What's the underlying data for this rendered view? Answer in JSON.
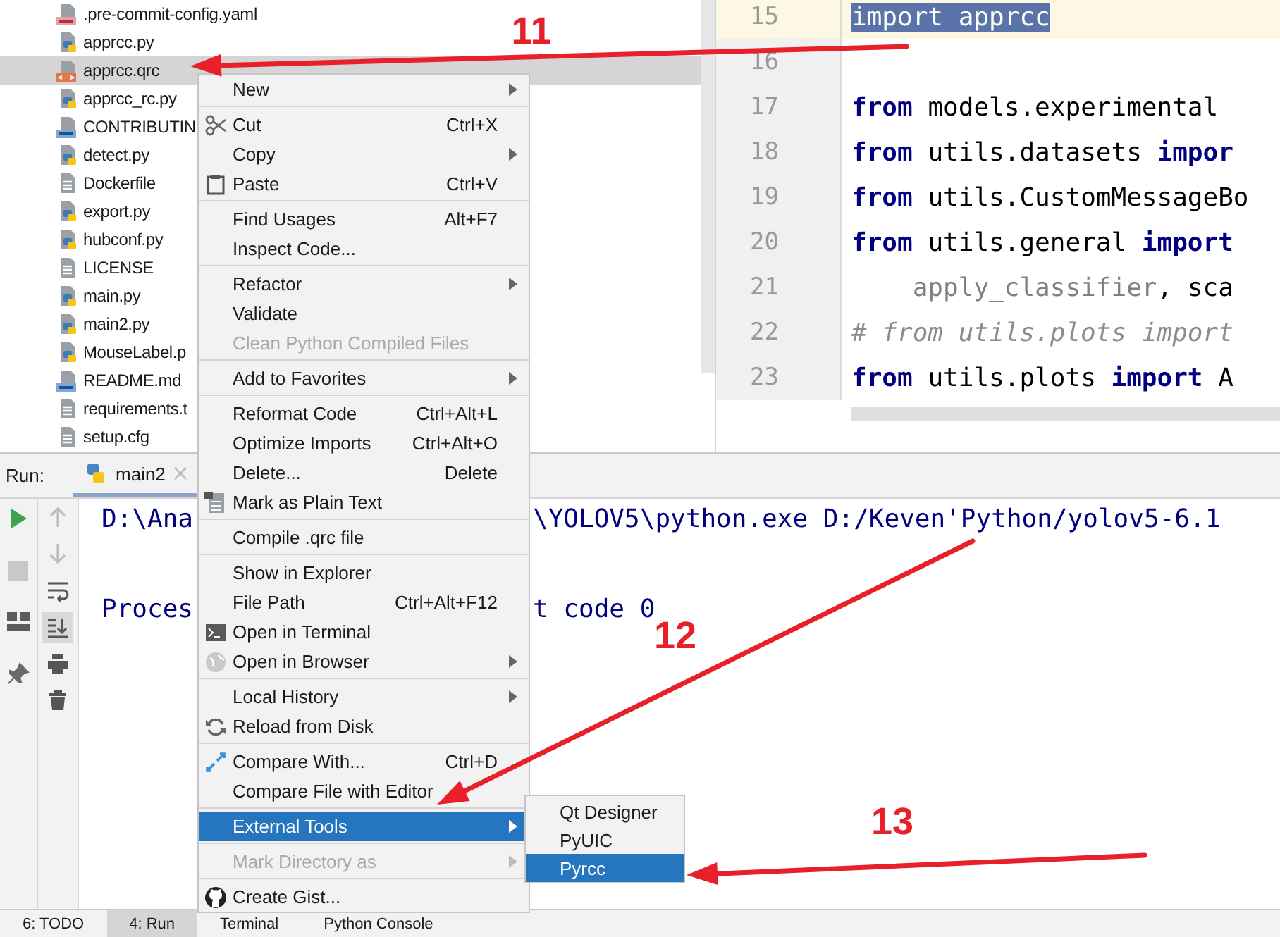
{
  "project_tree": {
    "items": [
      {
        "label": ".pre-commit-config.yaml",
        "kind": "yaml",
        "selected": false
      },
      {
        "label": "apprcc.py",
        "kind": "python",
        "selected": false
      },
      {
        "label": "apprcc.qrc",
        "kind": "qrc",
        "selected": true
      },
      {
        "label": "apprcc_rc.py",
        "kind": "python",
        "selected": false
      },
      {
        "label": "CONTRIBUTIN",
        "kind": "markdown",
        "selected": false
      },
      {
        "label": "detect.py",
        "kind": "python",
        "selected": false
      },
      {
        "label": "Dockerfile",
        "kind": "text",
        "selected": false
      },
      {
        "label": "export.py",
        "kind": "python",
        "selected": false
      },
      {
        "label": "hubconf.py",
        "kind": "python",
        "selected": false
      },
      {
        "label": "LICENSE",
        "kind": "text",
        "selected": false
      },
      {
        "label": "main.py",
        "kind": "python",
        "selected": false
      },
      {
        "label": "main2.py",
        "kind": "python",
        "selected": false
      },
      {
        "label": "MouseLabel.p",
        "kind": "python",
        "selected": false
      },
      {
        "label": "README.md",
        "kind": "markdown",
        "selected": false
      },
      {
        "label": "requirements.t",
        "kind": "text",
        "selected": false
      },
      {
        "label": "setup.cfg",
        "kind": "text",
        "selected": false
      }
    ]
  },
  "editor": {
    "lines": [
      {
        "number": "15",
        "current": true,
        "tokens": [
          {
            "text": "import apprcc",
            "kind": "selection"
          }
        ]
      },
      {
        "number": "16",
        "current": false
      },
      {
        "number": "17",
        "current": false,
        "tokens": [
          {
            "text": "from",
            "kind": "keyword"
          },
          {
            "text": " models.experimental",
            "kind": "plain"
          }
        ]
      },
      {
        "number": "18",
        "current": false,
        "tokens": [
          {
            "text": "from",
            "kind": "keyword"
          },
          {
            "text": " utils.datasets ",
            "kind": "plain"
          },
          {
            "text": "impor",
            "kind": "keyword"
          }
        ]
      },
      {
        "number": "19",
        "current": false,
        "tokens": [
          {
            "text": "from",
            "kind": "keyword"
          },
          {
            "text": " utils.CustomMessageBo",
            "kind": "plain"
          }
        ]
      },
      {
        "number": "20",
        "current": false,
        "tokens": [
          {
            "text": "from",
            "kind": "keyword"
          },
          {
            "text": " utils.general ",
            "kind": "plain"
          },
          {
            "text": "import",
            "kind": "keyword"
          }
        ]
      },
      {
        "number": "21",
        "current": false,
        "tokens": [
          {
            "text": "    apply_classifier",
            "kind": "muted"
          },
          {
            "text": ", sca",
            "kind": "plain"
          }
        ]
      },
      {
        "number": "22",
        "current": false,
        "tokens": [
          {
            "text": "# from utils.plots import",
            "kind": "comment"
          }
        ]
      },
      {
        "number": "23",
        "current": false,
        "tokens": [
          {
            "text": "from",
            "kind": "keyword"
          },
          {
            "text": " utils.plots ",
            "kind": "plain"
          },
          {
            "text": "import",
            "kind": "keyword"
          },
          {
            "text": " A",
            "kind": "plain"
          }
        ]
      }
    ]
  },
  "run_panel": {
    "label": "Run:",
    "tab": "main2",
    "tools": [
      {
        "selected": false
      },
      {
        "selected": false
      },
      {
        "selected": false
      },
      {
        "selected": true
      },
      {
        "selected": false
      },
      {
        "selected": false
      }
    ],
    "console": [
      {
        "left": "D:\\Ana",
        "right": "\\YOLOV5\\python.exe D:/Keven'Python/yolov5-6.1"
      },
      {
        "left": "Proces",
        "right": "t code 0"
      }
    ]
  },
  "context_menu": {
    "groups": [
      [
        {
          "label": "New",
          "submenu": true,
          "disabled": false,
          "selected": false
        }
      ],
      [
        {
          "label": "Cut",
          "shortcut": "Ctrl+X",
          "submenu": false,
          "disabled": false,
          "selected": false
        },
        {
          "label": "Copy",
          "submenu": true,
          "disabled": false,
          "selected": false
        },
        {
          "label": "Paste",
          "shortcut": "Ctrl+V",
          "submenu": false,
          "disabled": false,
          "selected": false
        }
      ],
      [
        {
          "label": "Find Usages",
          "shortcut": "Alt+F7",
          "submenu": false,
          "disabled": false,
          "selected": false
        },
        {
          "label": "Inspect Code...",
          "submenu": false,
          "disabled": false,
          "selected": false
        }
      ],
      [
        {
          "label": "Refactor",
          "submenu": true,
          "disabled": false,
          "selected": false
        },
        {
          "label": "Validate",
          "submenu": false,
          "disabled": false,
          "selected": false
        },
        {
          "label": "Clean Python Compiled Files",
          "submenu": false,
          "disabled": true,
          "selected": false
        }
      ],
      [
        {
          "label": "Add to Favorites",
          "submenu": true,
          "disabled": false,
          "selected": false
        }
      ],
      [
        {
          "label": "Reformat Code",
          "shortcut": "Ctrl+Alt+L",
          "submenu": false,
          "disabled": false,
          "selected": false
        },
        {
          "label": "Optimize Imports",
          "shortcut": "Ctrl+Alt+O",
          "submenu": false,
          "disabled": false,
          "selected": false
        },
        {
          "label": "Delete...",
          "shortcut": "Delete",
          "submenu": false,
          "disabled": false,
          "selected": false
        },
        {
          "label": "Mark as Plain Text",
          "submenu": false,
          "disabled": false,
          "selected": false
        }
      ],
      [
        {
          "label": "Compile .qrc file",
          "submenu": false,
          "disabled": false,
          "selected": false
        }
      ],
      [
        {
          "label": "Show in Explorer",
          "submenu": false,
          "disabled": false,
          "selected": false
        },
        {
          "label": "File Path",
          "shortcut": "Ctrl+Alt+F12",
          "submenu": false,
          "disabled": false,
          "selected": false
        },
        {
          "label": "Open in Terminal",
          "submenu": false,
          "disabled": false,
          "selected": false
        },
        {
          "label": "Open in Browser",
          "submenu": true,
          "disabled": false,
          "selected": false
        }
      ],
      [
        {
          "label": "Local History",
          "submenu": true,
          "disabled": false,
          "selected": false
        },
        {
          "label": "Reload from Disk",
          "submenu": false,
          "disabled": false,
          "selected": false
        }
      ],
      [
        {
          "label": "Compare With...",
          "shortcut": "Ctrl+D",
          "submenu": false,
          "disabled": false,
          "selected": false
        },
        {
          "label": "Compare File with Editor",
          "submenu": false,
          "disabled": false,
          "selected": false
        }
      ],
      [
        {
          "label": "External Tools",
          "submenu": true,
          "disabled": false,
          "selected": true
        }
      ],
      [
        {
          "label": "Mark Directory as",
          "submenu": true,
          "disabled": true,
          "selected": false
        }
      ],
      [
        {
          "label": "Create Gist...",
          "submenu": false,
          "disabled": false,
          "selected": false
        }
      ]
    ]
  },
  "submenu": {
    "items": [
      {
        "label": "Qt Designer",
        "selected": false
      },
      {
        "label": "PyUIC",
        "selected": false
      },
      {
        "label": "Pyrcc",
        "selected": true
      }
    ]
  },
  "bottom_tabs": [
    {
      "label": "6: TODO",
      "selected": false
    },
    {
      "label": "4: Run",
      "selected": true
    },
    {
      "label": "Terminal",
      "selected": false
    },
    {
      "label": "Python Console",
      "selected": false
    }
  ],
  "annotations": [
    {
      "label": "11"
    },
    {
      "label": "12"
    },
    {
      "label": "13"
    }
  ]
}
